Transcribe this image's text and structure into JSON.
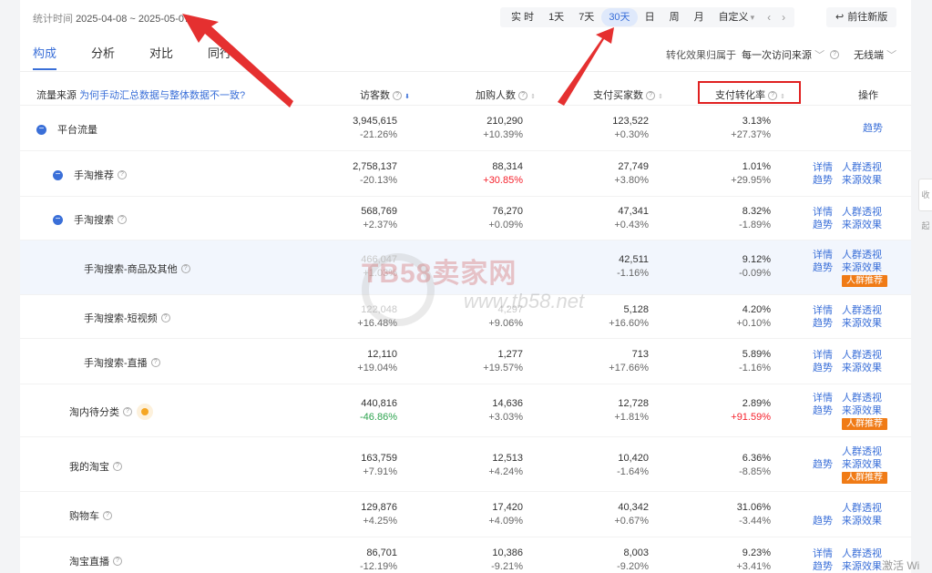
{
  "header": {
    "date_label": "统计时间",
    "date_value": "2025-04-08 ~ 2025-05-07",
    "periods": [
      "实 时",
      "1天",
      "7天",
      "30天",
      "日",
      "周",
      "月",
      "自定义"
    ],
    "active_period": "30天",
    "goto_new": "前往新版"
  },
  "tabs": [
    "构成",
    "分析",
    "对比",
    "同行"
  ],
  "active_tab": "构成",
  "attribution": {
    "label": "转化效果归属于",
    "value": "每一次访问来源",
    "device": "无线端"
  },
  "columns": {
    "source": "流量来源",
    "source_link": "为何手动汇总数据与整体数据不一致?",
    "visitors": "访客数",
    "cart": "加购人数",
    "buyers": "支付买家数",
    "conversion": "支付转化率",
    "ops": "操作"
  },
  "ops_labels": {
    "trend": "趋势",
    "detail": "详情",
    "crowd": "人群透视",
    "source_effect": "来源效果",
    "recommend": "人群推荐"
  },
  "rows": [
    {
      "name": "平台流量",
      "visitors": "3,945,615",
      "visitors_pct": "-21.26%",
      "cart": "210,290",
      "cart_pct": "+10.39%",
      "buyers": "123,522",
      "buyers_pct": "+0.30%",
      "conv": "3.13%",
      "conv_pct": "+27.37%"
    },
    {
      "name": "手淘推荐",
      "visitors": "2,758,137",
      "visitors_pct": "-20.13%",
      "cart": "88,314",
      "cart_pct": "+30.85%",
      "buyers": "27,749",
      "buyers_pct": "+3.80%",
      "conv": "1.01%",
      "conv_pct": "+29.95%"
    },
    {
      "name": "手淘搜索",
      "visitors": "568,769",
      "visitors_pct": "+2.37%",
      "cart": "76,270",
      "cart_pct": "+0.09%",
      "buyers": "47,341",
      "buyers_pct": "+0.43%",
      "conv": "8.32%",
      "conv_pct": "-1.89%"
    },
    {
      "name": "手淘搜索-商品及其他",
      "visitors": "466,047",
      "visitors_pct": "+1.03%",
      "cart": "",
      "cart_pct": "",
      "buyers": "42,511",
      "buyers_pct": "-1.16%",
      "conv": "9.12%",
      "conv_pct": "-0.09%"
    },
    {
      "name": "手淘搜索-短视频",
      "visitors": "122,048",
      "visitors_pct": "+16.48%",
      "cart": "4,297",
      "cart_pct": "+9.06%",
      "buyers": "5,128",
      "buyers_pct": "+16.60%",
      "conv": "4.20%",
      "conv_pct": "+0.10%"
    },
    {
      "name": "手淘搜索-直播",
      "visitors": "12,110",
      "visitors_pct": "+19.04%",
      "cart": "1,277",
      "cart_pct": "+19.57%",
      "buyers": "713",
      "buyers_pct": "+17.66%",
      "conv": "5.89%",
      "conv_pct": "-1.16%"
    },
    {
      "name": "淘内待分类",
      "visitors": "440,816",
      "visitors_pct": "-46.86%",
      "cart": "14,636",
      "cart_pct": "+3.03%",
      "buyers": "12,728",
      "buyers_pct": "+1.81%",
      "conv": "2.89%",
      "conv_pct": "+91.59%"
    },
    {
      "name": "我的淘宝",
      "visitors": "163,759",
      "visitors_pct": "+7.91%",
      "cart": "12,513",
      "cart_pct": "+4.24%",
      "buyers": "10,420",
      "buyers_pct": "-1.64%",
      "conv": "6.36%",
      "conv_pct": "-8.85%"
    },
    {
      "name": "购物车",
      "visitors": "129,876",
      "visitors_pct": "+4.25%",
      "cart": "17,420",
      "cart_pct": "+4.09%",
      "buyers": "40,342",
      "buyers_pct": "+0.67%",
      "conv": "31.06%",
      "conv_pct": "-3.44%"
    },
    {
      "name": "淘宝直播",
      "visitors": "86,701",
      "visitors_pct": "-12.19%",
      "cart": "10,386",
      "cart_pct": "-9.21%",
      "buyers": "8,003",
      "buyers_pct": "-9.20%",
      "conv": "9.23%",
      "conv_pct": "+3.41%"
    }
  ],
  "watermark": {
    "brand": "TB58卖家网",
    "url": "www.tb58.net"
  },
  "side_tab": "收起",
  "activate_text": "激活 Wi",
  "colors": {
    "accent": "#3a6fd8",
    "red": "#f5222d",
    "green": "#2ea44f",
    "badge": "#f07b16",
    "annotation": "#e02020"
  }
}
